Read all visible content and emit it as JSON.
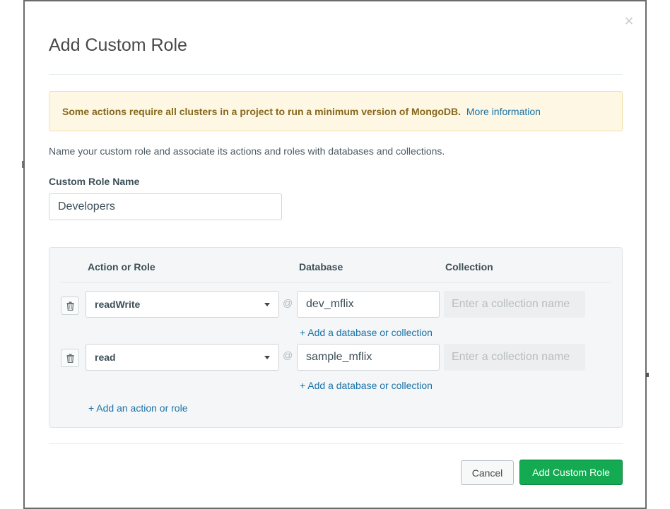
{
  "dialog": {
    "title": "Add Custom Role",
    "close_glyph": "×"
  },
  "banner": {
    "text": "Some actions require all clusters in a project to run a minimum version of MongoDB.",
    "link": "More information"
  },
  "intro": "Name your custom role and associate its actions and roles with databases and collections.",
  "role_name": {
    "label": "Custom Role Name",
    "value": "Developers"
  },
  "table": {
    "headers": {
      "action": "Action or Role",
      "database": "Database",
      "collection": "Collection"
    },
    "rows": [
      {
        "action": "readWrite",
        "at": "@",
        "database": "dev_mflix",
        "collection_placeholder": "Enter a collection name",
        "add_link": "+ Add a database or collection"
      },
      {
        "action": "read",
        "at": "@",
        "database": "sample_mflix",
        "collection_placeholder": "Enter a collection name",
        "add_link": "+ Add a database or collection"
      }
    ],
    "add_action": "+ Add an action or role"
  },
  "footer": {
    "cancel": "Cancel",
    "submit": "Add Custom Role"
  },
  "colors": {
    "primary": "#13aa52",
    "link": "#1a73a8",
    "banner_bg": "#fef7e3",
    "banner_text": "#86681d"
  }
}
